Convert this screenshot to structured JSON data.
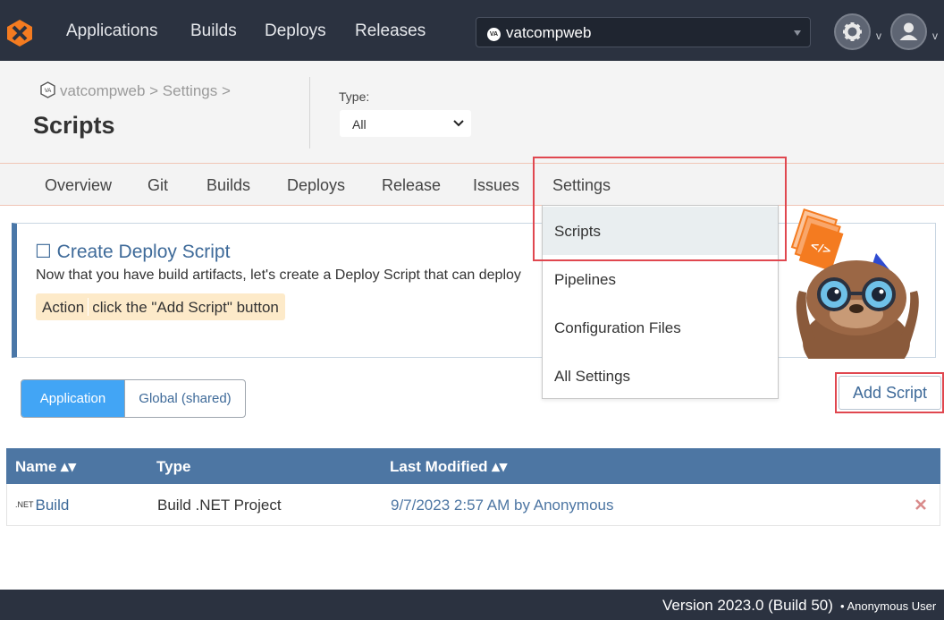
{
  "topnav": {
    "nav_items": [
      "Applications",
      "Builds",
      "Deploys",
      "Releases"
    ],
    "app_selector_value": "vatcompweb",
    "app_badge": "VA",
    "settings_caret": "v",
    "user_caret": "v"
  },
  "header": {
    "breadcrumb": "vatcompweb > Settings >",
    "title": "Scripts",
    "type_label": "Type:",
    "type_value": "All"
  },
  "tabs": [
    "Overview",
    "Git",
    "Builds",
    "Deploys",
    "Release",
    "Issues",
    "Settings"
  ],
  "settings_menu": [
    "Scripts",
    "Pipelines",
    "Configuration Files",
    "All Settings"
  ],
  "callout": {
    "title": "☐ Create Deploy Script",
    "description": "Now that you have build artifacts, let's create a Deploy Script that can deploy",
    "action_label": "Action",
    "action_text": "click the \"Add Script\" button"
  },
  "scope_toggle": {
    "application": "Application",
    "global": "Global (shared)"
  },
  "add_script_label": "Add Script",
  "table": {
    "columns": [
      "Name ▴▾",
      "Type",
      "Last Modified ▴▾"
    ],
    "rows": [
      {
        "badge": ".NET",
        "name": "Build",
        "type": "Build .NET Project",
        "modified": "9/7/2023 2:57 AM by Anonymous"
      }
    ]
  },
  "footer": {
    "version": "Version 2023.0 (Build 50)",
    "user": "• Anonymous User"
  },
  "colors": {
    "nav_bg": "#2b3240",
    "accent": "#4d76a3",
    "primary": "#42a5f5",
    "highlight": "#e0474f"
  }
}
